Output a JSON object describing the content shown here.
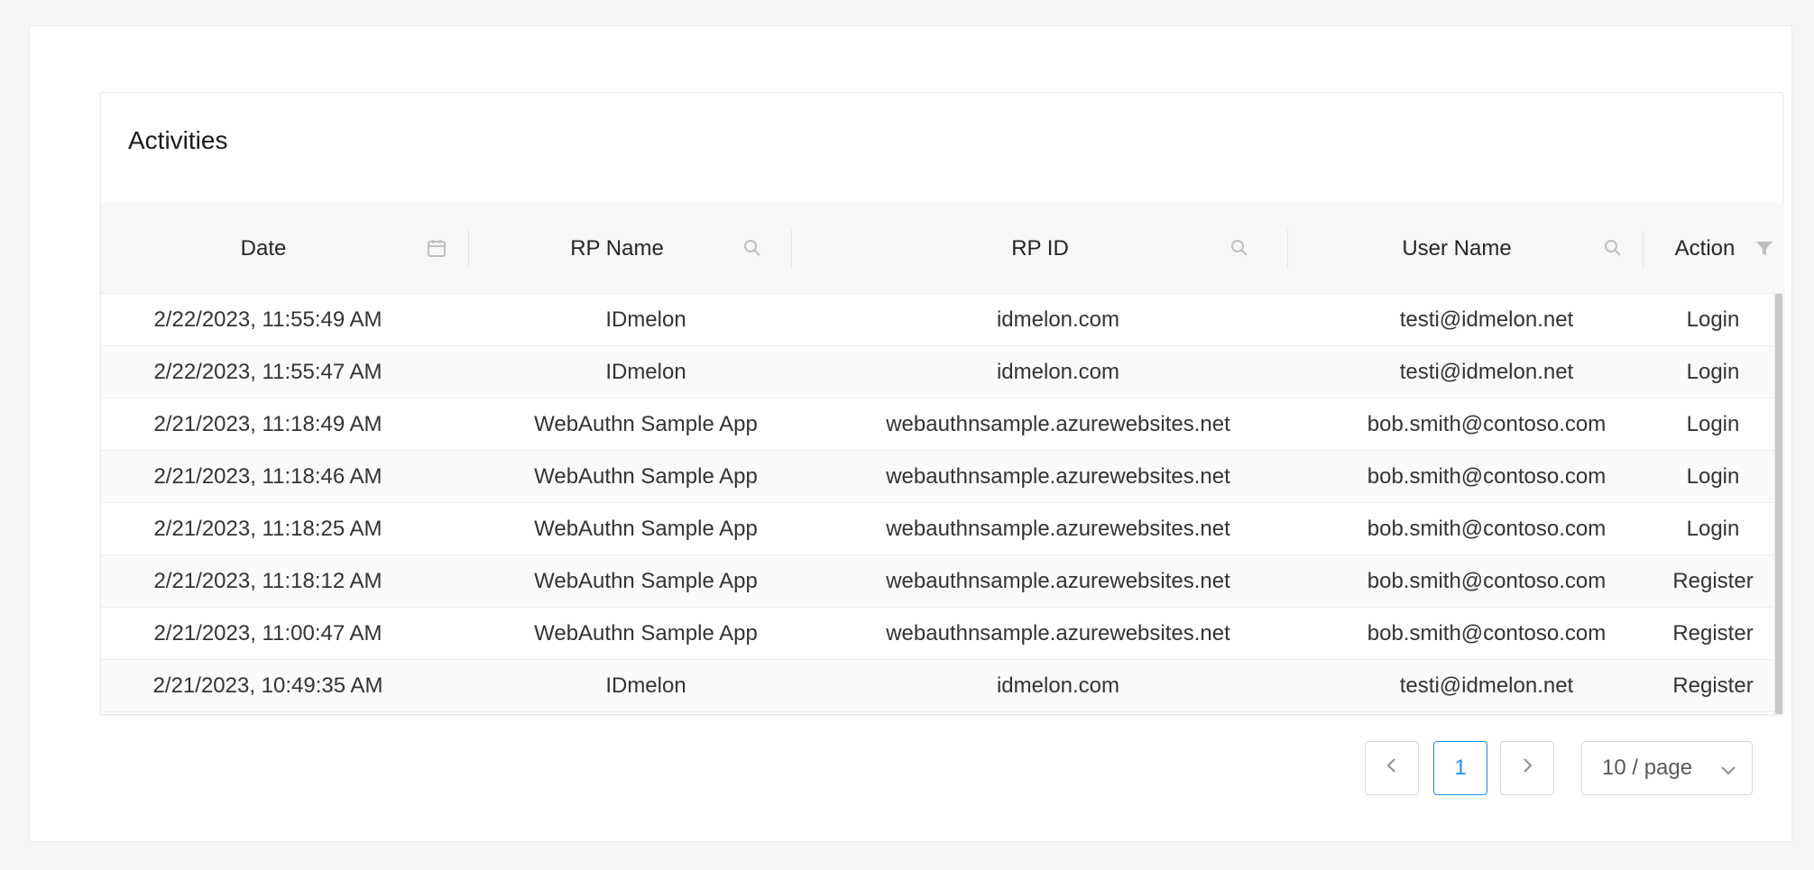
{
  "card": {
    "title": "Activities"
  },
  "table": {
    "columns": [
      {
        "label": "Date",
        "icon": "calendar-icon"
      },
      {
        "label": "RP Name",
        "icon": "search-icon"
      },
      {
        "label": "RP ID",
        "icon": "search-icon"
      },
      {
        "label": "User Name",
        "icon": "search-icon"
      },
      {
        "label": "Action",
        "icon": "filter-icon"
      }
    ],
    "rows": [
      {
        "date": "2/22/2023, 11:55:49 AM",
        "rp_name": "IDmelon",
        "rp_id": "idmelon.com",
        "user": "testi@idmelon.net",
        "action": "Login"
      },
      {
        "date": "2/22/2023, 11:55:47 AM",
        "rp_name": "IDmelon",
        "rp_id": "idmelon.com",
        "user": "testi@idmelon.net",
        "action": "Login"
      },
      {
        "date": "2/21/2023, 11:18:49 AM",
        "rp_name": "WebAuthn Sample App",
        "rp_id": "webauthnsample.azurewebsites.net",
        "user": "bob.smith@contoso.com",
        "action": "Login"
      },
      {
        "date": "2/21/2023, 11:18:46 AM",
        "rp_name": "WebAuthn Sample App",
        "rp_id": "webauthnsample.azurewebsites.net",
        "user": "bob.smith@contoso.com",
        "action": "Login"
      },
      {
        "date": "2/21/2023, 11:18:25 AM",
        "rp_name": "WebAuthn Sample App",
        "rp_id": "webauthnsample.azurewebsites.net",
        "user": "bob.smith@contoso.com",
        "action": "Login"
      },
      {
        "date": "2/21/2023, 11:18:12 AM",
        "rp_name": "WebAuthn Sample App",
        "rp_id": "webauthnsample.azurewebsites.net",
        "user": "bob.smith@contoso.com",
        "action": "Register"
      },
      {
        "date": "2/21/2023, 11:00:47 AM",
        "rp_name": "WebAuthn Sample App",
        "rp_id": "webauthnsample.azurewebsites.net",
        "user": "bob.smith@contoso.com",
        "action": "Register"
      },
      {
        "date": "2/21/2023, 10:49:35 AM",
        "rp_name": "IDmelon",
        "rp_id": "idmelon.com",
        "user": "testi@idmelon.net",
        "action": "Register"
      }
    ]
  },
  "pagination": {
    "current_page": "1",
    "page_size": "10 / page",
    "prev_icon": "chevron-left-icon",
    "next_icon": "chevron-right-icon"
  },
  "colors": {
    "accent": "#1890ff",
    "header_bg": "#f7f7f7",
    "border": "#ececec"
  }
}
